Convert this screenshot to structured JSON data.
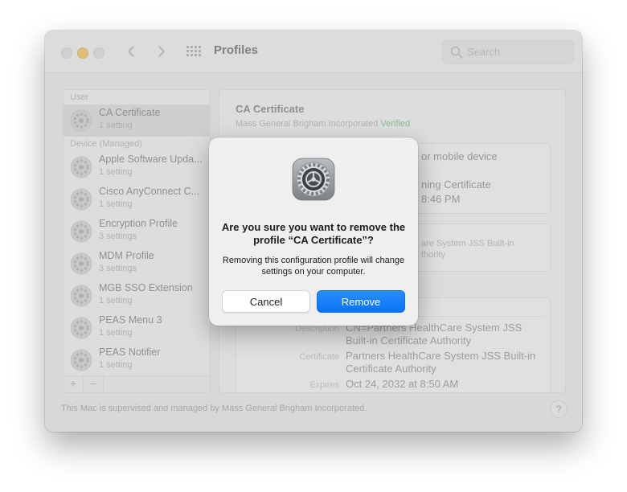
{
  "window": {
    "title": "Profiles",
    "search_placeholder": "Search",
    "nav_back": "‹",
    "nav_forward": "›"
  },
  "sidebar": {
    "section_user": "User",
    "section_device": "Device (Managed)",
    "items": [
      {
        "name": "CA Certificate",
        "sub": "1 setting",
        "selected": true
      },
      {
        "name": "Apple Software Upda...",
        "sub": "1 setting"
      },
      {
        "name": "Cisco AnyConnect C...",
        "sub": "1 setting"
      },
      {
        "name": "Encryption Profile",
        "sub": "3 settings"
      },
      {
        "name": "MDM Profile",
        "sub": "3 settings"
      },
      {
        "name": "MGB SSO Extension",
        "sub": "1 setting"
      },
      {
        "name": "PEAS Menu 3",
        "sub": "1 setting"
      },
      {
        "name": "PEAS Notifier",
        "sub": "1 setting"
      }
    ],
    "add_label": "+",
    "remove_label": "−"
  },
  "detail": {
    "title": "CA Certificate",
    "org": "Mass General Brigham Incorporated",
    "verified": "Verified",
    "box1_line1": "or mobile device",
    "box1_line2": "ning Certificate",
    "box1_line3": "8:46 PM",
    "box2_line1": "are System JSS Built-in",
    "box2_line2": "thority",
    "description_key": "Description",
    "description_value": "CN=Partners HealthCare System JSS Built-in Certificate Authority",
    "certificate_key": "Certificate",
    "certificate_value": "Partners HealthCare System JSS Built-in Certificate Authority",
    "expires_key": "Expires",
    "expires_value": "Oct 24, 2032 at 8:50 AM"
  },
  "footer": {
    "text": "This Mac is supervised and managed by Mass General Brigham Incorporated.",
    "help": "?"
  },
  "dialog": {
    "icon": "system-preferences-gear-icon",
    "title": "Are you sure you want to remove the profile “CA Certificate”?",
    "message": "Removing this configuration profile will change settings on your computer.",
    "cancel_label": "Cancel",
    "confirm_label": "Remove"
  },
  "colors": {
    "accent": "#0a74f5",
    "verified": "#55b35e",
    "minimize": "#fbbb2c"
  }
}
